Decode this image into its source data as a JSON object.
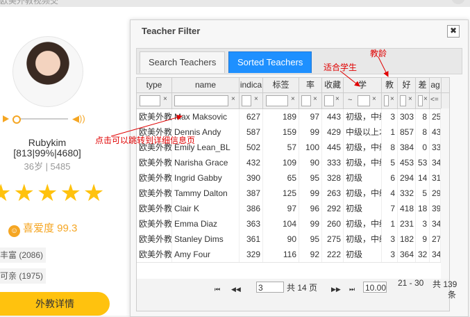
{
  "background": {
    "top_text": "欧美外教视频交"
  },
  "profile": {
    "name": "Rubykim",
    "stats": "[813|99%|4680]",
    "age_line": "36岁 | 5485",
    "stars": "★★★★★",
    "likes": "喜爱度 99.3",
    "tags": [
      "丰富 (2086)",
      "可亲 (1975)"
    ],
    "detail_button": "外教详情"
  },
  "dialog": {
    "title": "Teacher Filter",
    "close": "✖",
    "tabs": [
      "Search Teachers",
      "Sorted Teachers"
    ],
    "columns": [
      "type",
      "name",
      "indica",
      "标签",
      "率",
      "收藏",
      "学",
      "教",
      "好",
      "差",
      "ag"
    ],
    "filter_hint": {
      "x": "×",
      "tilde": "~",
      "lte": "<="
    },
    "rows": [
      [
        "欧美外教",
        "Max Maksovic",
        "627",
        "189",
        "97",
        "443",
        "初级，中级",
        "3",
        "303",
        "8",
        "25"
      ],
      [
        "欧美外教",
        "Dennis Andy",
        "587",
        "159",
        "99",
        "429",
        "中级以上才",
        "1",
        "857",
        "8",
        "43"
      ],
      [
        "欧美外教",
        "Emily Lean_BL",
        "502",
        "57",
        "100",
        "445",
        "初级，中级",
        "8",
        "384",
        "0",
        "33"
      ],
      [
        "欧美外教",
        "Narisha Grace",
        "432",
        "109",
        "90",
        "333",
        "初级，中级",
        "5",
        "453",
        "53",
        "34"
      ],
      [
        "欧美外教",
        "Ingrid Gabby",
        "390",
        "65",
        "95",
        "328",
        "初级",
        "6",
        "294",
        "14",
        "31"
      ],
      [
        "欧美外教",
        "Tammy Dalton",
        "387",
        "125",
        "99",
        "263",
        "初级，中级",
        "4",
        "332",
        "5",
        "29"
      ],
      [
        "欧美外教",
        "Clair K",
        "386",
        "97",
        "96",
        "292",
        "初级",
        "7",
        "418",
        "18",
        "39"
      ],
      [
        "欧美外教",
        "Emma Diaz",
        "363",
        "104",
        "99",
        "260",
        "初级，中级",
        "1",
        "231",
        "3",
        "34"
      ],
      [
        "欧美外教",
        "Stanley Dims",
        "361",
        "90",
        "95",
        "275",
        "初级，中级",
        "3",
        "182",
        "9",
        "27"
      ],
      [
        "欧美外教",
        "Amy Four",
        "329",
        "116",
        "92",
        "222",
        "初级",
        "3",
        "364",
        "32",
        "34"
      ]
    ],
    "pager": {
      "first": "⏮",
      "prev": "◀◀",
      "next": "▶▶",
      "last": "⏭",
      "page": "3",
      "of_pages": "共 14 页",
      "page_size": "10.00",
      "range": "21 - 30",
      "total_a": "共 139",
      "total_b": "条"
    }
  },
  "annotations": {
    "click_hint": "点击可以跳转到详细信息页",
    "suitable_students": "适合学生",
    "teaching_years": "教龄",
    "color": "#e00000"
  }
}
